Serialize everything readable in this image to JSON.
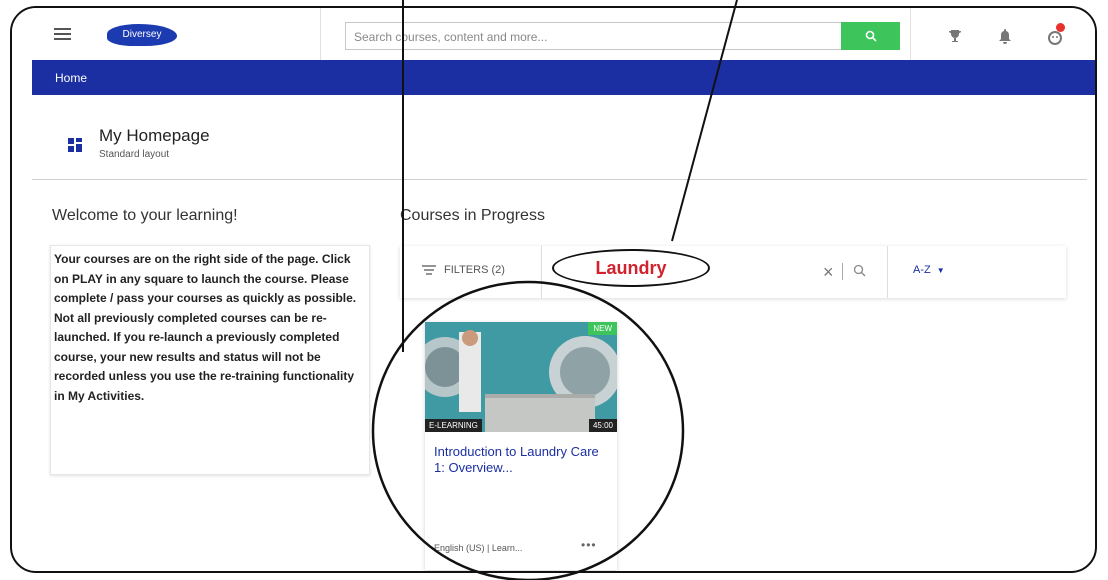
{
  "header": {
    "logo_text": "Diversey",
    "search_placeholder": "Search courses, content and more...",
    "icons": [
      "menu-icon",
      "search-icon",
      "trophy-icon",
      "bell-icon",
      "avatar-icon"
    ]
  },
  "breadcrumb": {
    "home": "Home"
  },
  "page": {
    "title": "My Homepage",
    "subtitle": "Standard layout"
  },
  "welcome": {
    "heading": "Welcome to your learning!",
    "text": "Your courses are on the right side of the page. Click on PLAY in any square to launch the course. Please complete / pass your courses as quickly as possible. Not all  previously completed courses can be re-launched. If you re-launch a previously completed course, your new results and status will not be recorded unless you use the re-training functionality in My Activities."
  },
  "courses": {
    "heading": "Courses in Progress",
    "filters_label": "FILTERS (2)",
    "search_value": "Laundry",
    "sort_label": "A-Z",
    "cards": [
      {
        "badge": "NEW",
        "type": "E-LEARNING",
        "duration": "45:00",
        "title": "Introduction to Laundry Care 1: Overview...",
        "meta": "English (US) | Learn...",
        "more": "•••"
      }
    ]
  },
  "colors": {
    "brand_blue": "#1b2fa3",
    "search_green": "#3dc55b",
    "highlight_red": "#d2222d",
    "notification_red": "#e8312c"
  }
}
